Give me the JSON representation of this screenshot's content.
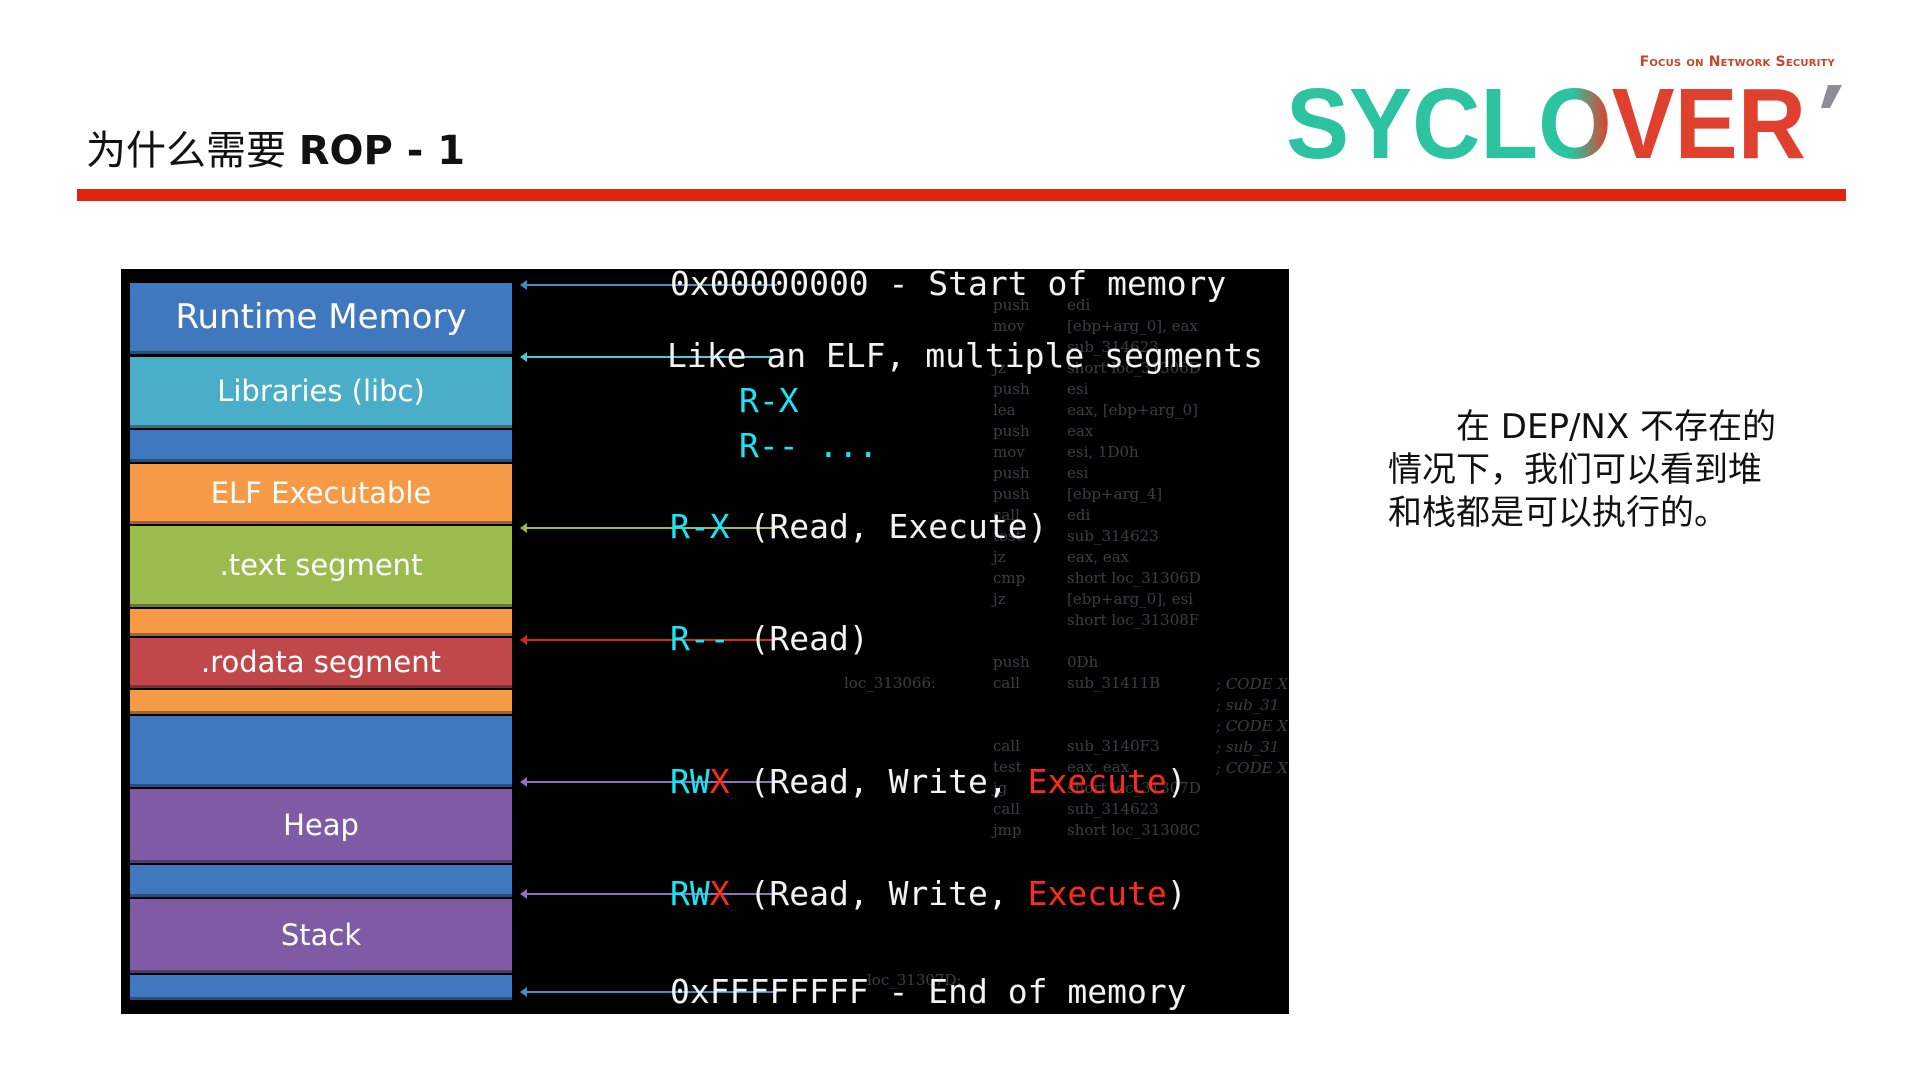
{
  "header": {
    "title_cn": "为什么需要",
    "title_en": "ROP - 1",
    "brand_tagline": "Focus on Network Security",
    "brand_logo": "SYCLOVER"
  },
  "memory_segments": [
    {
      "label": "Runtime Memory",
      "color": "#3f78bf"
    },
    {
      "label": "Libraries (libc)",
      "color": "#4aaec8"
    },
    {
      "label": "",
      "color": "#3f78bf"
    },
    {
      "label": "ELF Executable",
      "color": "#f79a46"
    },
    {
      "label": ".text segment",
      "color": "#9bbb4e"
    },
    {
      "label": "",
      "color": "#f79a46"
    },
    {
      "label": ".rodata segment",
      "color": "#c1484a"
    },
    {
      "label": "",
      "color": "#f79a46"
    },
    {
      "label": "",
      "color": "#3f78bf"
    },
    {
      "label": "Heap",
      "color": "#7f5ba6"
    },
    {
      "label": "",
      "color": "#3f78bf"
    },
    {
      "label": "Stack",
      "color": "#7f5ba6"
    },
    {
      "label": "",
      "color": "#3f78bf"
    }
  ],
  "annotations": {
    "start": "0x00000000 - Start of memory",
    "elf_line": "Like an ELF, multiple segments",
    "elf_rx": "R-X",
    "elf_r": "R-- ...",
    "text_perm": "R-X",
    "text_desc": "(Read, Execute)",
    "rodata_perm": "R--",
    "rodata_desc": "(Read)",
    "heap_perm_rw": "RW",
    "heap_perm_x": "X",
    "heap_desc": "(Read, Write, ",
    "heap_exec": "Execute",
    "heap_close": ")",
    "stack_perm_rw": "RW",
    "stack_perm_x": "X",
    "stack_desc": "(Read, Write, ",
    "stack_exec": "Execute",
    "stack_close": ")",
    "end": "0xFFFFFFFF - End of memory"
  },
  "arrow_colors": [
    "#3f8fc4",
    "#4fc9d6",
    "#9bbb4e",
    "#d9262a",
    "#8f6fbf",
    "#8f6fbf",
    "#3f8fc4"
  ],
  "background_code": {
    "mnemonics": [
      "push",
      "mov",
      "",
      "jz",
      "push",
      "lea",
      "push",
      "mov",
      "push",
      "push",
      "call",
      "test",
      "jz",
      "cmp",
      "jz",
      "",
      "",
      "push",
      "call",
      "",
      "",
      "call",
      "test",
      "jg",
      "call",
      "jmp"
    ],
    "operands": [
      "edi",
      "[ebp+arg_0], eax",
      "sub_314623",
      "short loc_31306D",
      "esi",
      "eax, [ebp+arg_0]",
      "eax",
      "esi, 1D0h",
      "esi",
      "[ebp+arg_4]",
      "edi",
      "sub_314623",
      "eax, eax",
      "short loc_31306D",
      "[ebp+arg_0], esi",
      "short loc_31308F",
      "",
      "0Dh",
      "sub_31411B",
      "",
      "",
      "sub_3140F3",
      "eax, eax",
      "short loc_31307D",
      "sub_314623",
      "short loc_31308C"
    ],
    "loc_label": "loc_313066:",
    "loc_label_2": "loc_31307D:",
    "comments": [
      "; CODE X",
      "; sub_31",
      "; CODE X",
      "; sub_31",
      "; CODE X"
    ]
  },
  "side_text": {
    "line1": "在 DEP/NX 不存在的",
    "line2": "情况下，我们可以看到堆",
    "line3": "和栈都是可以执行的。"
  }
}
